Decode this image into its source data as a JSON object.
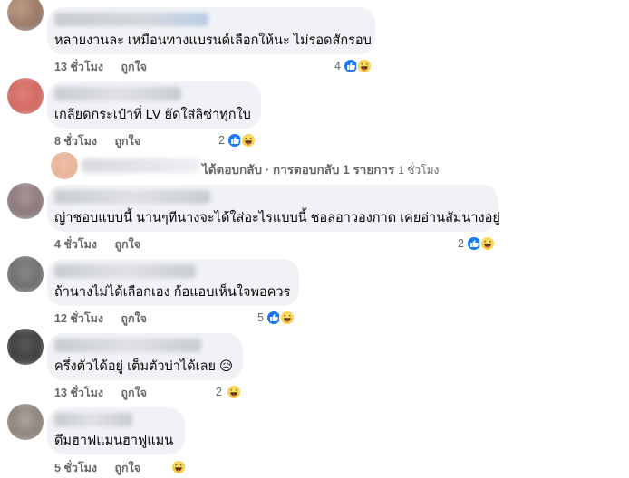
{
  "comments": [
    {
      "text": "หลายงานละ เหมือนทางแบรนด์เลือกให้นะ ไม่รอดสักรอบ",
      "time": "13 ชั่วโมง",
      "like_label": "ถูกใจ",
      "reaction_count": "4",
      "reactions": [
        "like-icon",
        "haha-icon"
      ]
    },
    {
      "text": "เกลียดกระเป๋าที่ LV ยัดใส่ลิซ่าทุกใบ",
      "time": "8 ชั่วโมง",
      "like_label": "ถูกใจ",
      "reaction_count": "2",
      "reactions": [
        "like-icon",
        "haha-icon"
      ]
    },
    {
      "text": "ญ่าชอบแบบนี้ นานๆทีนางจะได้ใส่อะไรแบบนี้ ชอลอาวองกาด เคยอ่านสัมนางอยู่",
      "time": "4 ชั่วโมง",
      "like_label": "ถูกใจ",
      "reaction_count": "2",
      "reactions": [
        "like-icon",
        "haha-icon"
      ]
    },
    {
      "text": "ถ้านางไม่ได้เลือกเอง ก้อแอบเห็นใจพอควร",
      "time": "12 ชั่วโมง",
      "like_label": "ถูกใจ",
      "reaction_count": "5",
      "reactions": [
        "like-icon",
        "haha-icon"
      ]
    },
    {
      "text": "ครึ่งตัวได้อยู่ เต็มตัวบ่าได้เลย 😥",
      "time": "13 ชั่วโมง",
      "like_label": "ถูกใจ",
      "reaction_count": "2",
      "reactions": [
        "haha-icon"
      ]
    },
    {
      "text": "ดึมฮาฟแมนฮาฟูแมน",
      "time": "5 ชั่วโมง",
      "like_label": "ถูกใจ",
      "reaction_count": "",
      "reactions": [
        "haha-icon"
      ]
    }
  ],
  "reply_summary": {
    "text": "ได้ตอบกลับ · การตอบกลับ 1 รายการ",
    "time": "1 ชั่วโมง"
  },
  "colors": {
    "bubble": "#f0f2f5",
    "meta": "#65676b",
    "like_blue": "#1877f2",
    "haha_yellow": "#f7c844"
  }
}
